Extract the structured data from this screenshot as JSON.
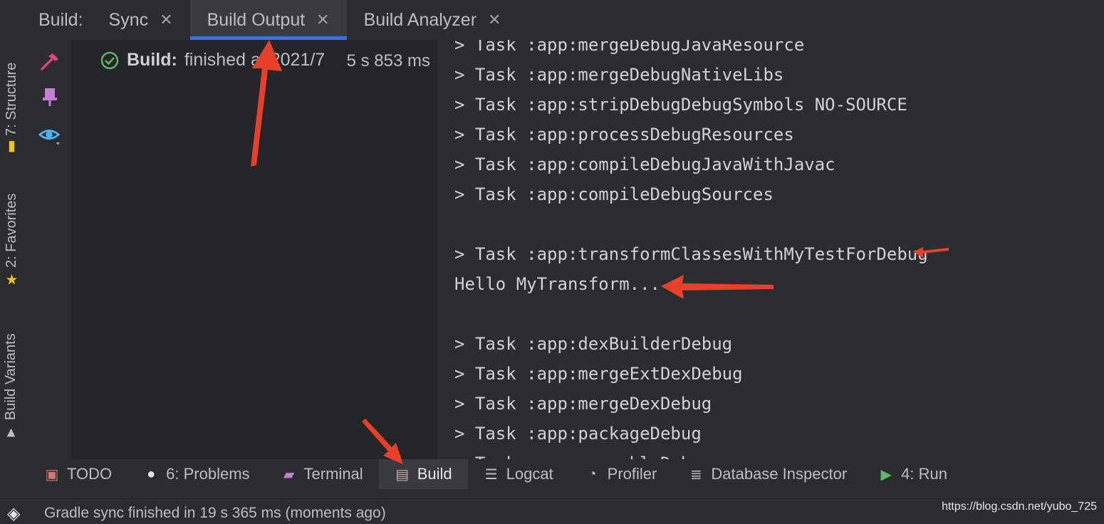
{
  "left_strip": {
    "structure_label": "7: Structure",
    "favorites_label": "2: Favorites",
    "build_variants_label": "Build Variants"
  },
  "tabbar": {
    "title": "Build:",
    "tabs": [
      {
        "label": "Sync",
        "active": false
      },
      {
        "label": "Build Output",
        "active": true
      },
      {
        "label": "Build Analyzer",
        "active": false
      }
    ]
  },
  "tree": {
    "status_bold": "Build:",
    "status_text": "finished at 2021/7",
    "duration": "5 s 853 ms"
  },
  "console": {
    "lines": [
      "> Task :app:mergeDebugJavaResource",
      "> Task :app:mergeDebugNativeLibs",
      "> Task :app:stripDebugDebugSymbols NO-SOURCE",
      "> Task :app:processDebugResources",
      "> Task :app:compileDebugJavaWithJavac",
      "> Task :app:compileDebugSources",
      "",
      "> Task :app:transformClassesWithMyTestForDebug",
      "Hello MyTransform...",
      "",
      "> Task :app:dexBuilderDebug",
      "> Task :app:mergeExtDexDebug",
      "> Task :app:mergeDexDebug",
      "> Task :app:packageDebug",
      "> Task :app:assembleDebug"
    ]
  },
  "bottombar": {
    "items": [
      {
        "label": "TODO",
        "icon": "todo-icon"
      },
      {
        "label": "6: Problems",
        "icon": "problems-icon"
      },
      {
        "label": "Terminal",
        "icon": "terminal-icon"
      },
      {
        "label": "Build",
        "icon": "build-icon",
        "active": true
      },
      {
        "label": "Logcat",
        "icon": "logcat-icon"
      },
      {
        "label": "Profiler",
        "icon": "profiler-icon"
      },
      {
        "label": "Database Inspector",
        "icon": "database-icon"
      },
      {
        "label": "4: Run",
        "icon": "run-icon"
      }
    ]
  },
  "statusbar": {
    "text": "Gradle sync finished in 19 s 365 ms (moments ago)",
    "watermark": "https://blog.csdn.net/yubo_725"
  },
  "colors": {
    "accent": "#3574f0",
    "success": "#5fb865",
    "hammer": "#e0467a",
    "pin": "#c77dd6",
    "eye": "#4fb4f0",
    "annotation": "#e8402b"
  }
}
